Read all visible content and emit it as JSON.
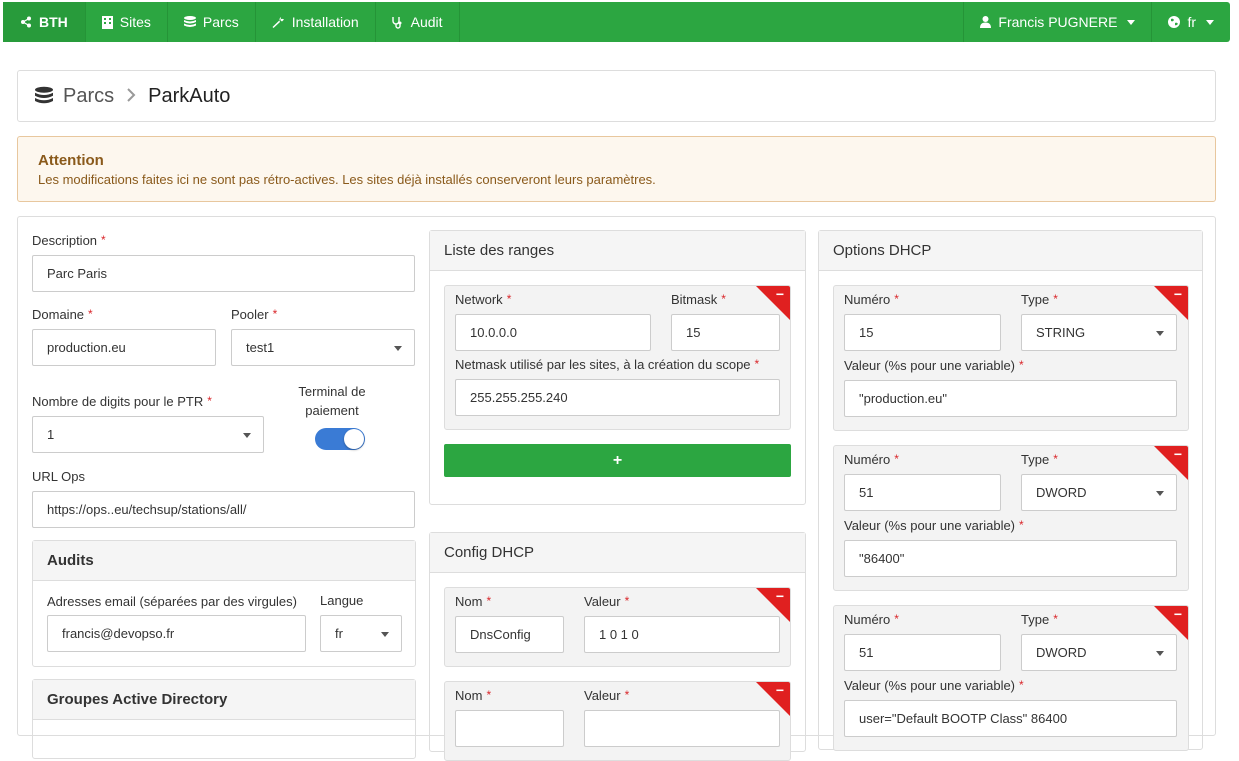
{
  "navbar": {
    "brand": "BTH",
    "items": [
      {
        "label": "Sites"
      },
      {
        "label": "Parcs"
      },
      {
        "label": "Installation"
      },
      {
        "label": "Audit"
      }
    ],
    "user": "Francis PUGNERE",
    "lang": "fr"
  },
  "breadcrumb": {
    "parent": "Parcs",
    "current": "ParkAuto"
  },
  "alert": {
    "title": "Attention",
    "text": "Les modifications faites ici ne sont pas rétro-actives. Les sites déjà installés conserveront leurs paramètres."
  },
  "form": {
    "description": {
      "label": "Description",
      "value": "Parc Paris"
    },
    "domaine": {
      "label": "Domaine",
      "value": "production.eu"
    },
    "pooler": {
      "label": "Pooler",
      "value": "test1"
    },
    "ptr": {
      "label": "Nombre de digits pour le PTR",
      "value": "1"
    },
    "terminal": {
      "label_line1": "Terminal de",
      "label_line2": "paiement",
      "on": true
    },
    "url_ops": {
      "label": "URL Ops",
      "value": "https://ops..eu/techsup/stations/all/"
    }
  },
  "audits": {
    "title": "Audits",
    "email_label": "Adresses email (séparées par des virgules)",
    "email_value": "francis@devopso.fr",
    "langue_label": "Langue",
    "langue_value": "fr"
  },
  "ad_groups": {
    "title": "Groupes Active Directory"
  },
  "ranges": {
    "title": "Liste des ranges",
    "network_label": "Network",
    "bitmask_label": "Bitmask",
    "netmask_label": "Netmask utilisé par les sites, à la création du scope",
    "items": [
      {
        "network": "10.0.0.0",
        "bitmask": "15",
        "netmask": "255.255.255.240"
      }
    ],
    "add_symbol": "+",
    "remove_symbol": "−"
  },
  "config_dhcp": {
    "title": "Config DHCP",
    "nom_label": "Nom",
    "valeur_label": "Valeur",
    "items": [
      {
        "nom": "DnsConfig",
        "valeur": "1 0 1 0"
      },
      {
        "nom": "",
        "valeur": ""
      }
    ]
  },
  "options_dhcp": {
    "title": "Options DHCP",
    "numero_label": "Numéro",
    "type_label": "Type",
    "valeur_label": "Valeur (%s pour une variable)",
    "items": [
      {
        "numero": "15",
        "type": "STRING",
        "valeur": "\"production.eu\""
      },
      {
        "numero": "51",
        "type": "DWORD",
        "valeur": "\"86400\""
      },
      {
        "numero": "51",
        "type": "DWORD",
        "valeur": "user=\"Default BOOTP Class\" 86400"
      }
    ]
  },
  "colors": {
    "navbar": "#2ca641",
    "remove": "#e02020",
    "toggle": "#3a7bd5",
    "alert_bg": "#fdf7ee"
  }
}
